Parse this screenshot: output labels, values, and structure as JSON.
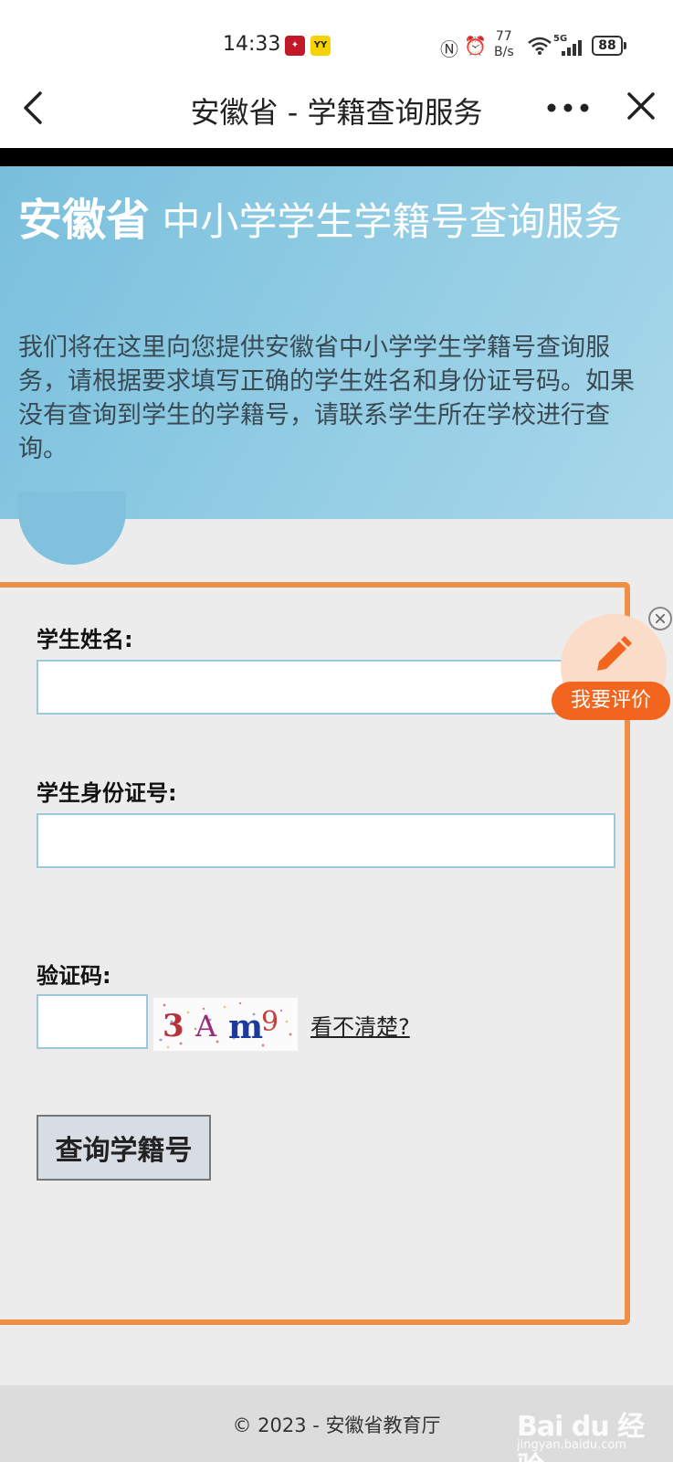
{
  "status_bar": {
    "time": "14:33",
    "net_speed_value": "77",
    "net_speed_unit": "B/s",
    "signal_label": "5G",
    "battery": "88"
  },
  "nav": {
    "title": "安徽省 - 学籍查询服务"
  },
  "banner": {
    "title_bold": "安徽省",
    "title_rest": "中小学学生学籍号查询服务",
    "description": "我们将在这里向您提供安徽省中小学学生学籍号查询服务，请根据要求填写正确的学生姓名和身份证号码。如果没有查询到学生的学籍号，请联系学生所在学校进行查询。"
  },
  "form": {
    "name_label": "学生姓名:",
    "name_value": "",
    "id_label": "学生身份证号:",
    "id_value": "",
    "captcha_label": "验证码:",
    "captcha_value": "",
    "captcha_text": "3Am9",
    "captcha_refresh_link": "看不清楚?",
    "submit_label": "查询学籍号"
  },
  "feedback": {
    "label": "我要评价"
  },
  "footer": {
    "copyright": "© 2023 - 安徽省教育厅"
  },
  "watermark": {
    "brand": "Bai du 经验",
    "url": "jingyan.baidu.com"
  },
  "colors": {
    "highlight_border": "#ef8f45",
    "feedback_orange": "#f2651e",
    "banner_blue": "#8ecbe3"
  }
}
